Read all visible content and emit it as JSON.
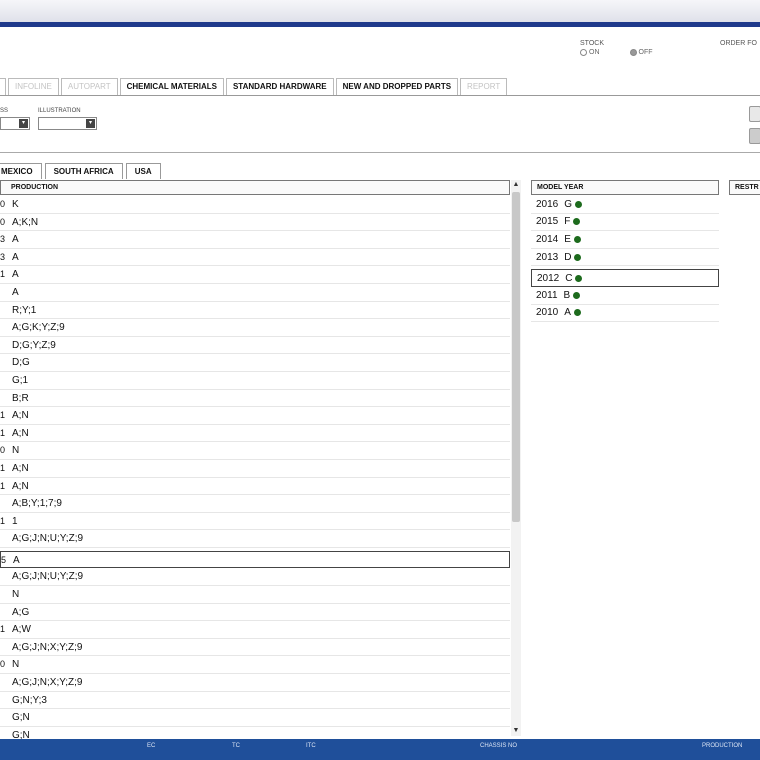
{
  "stock": {
    "label": "STOCK",
    "on_label": "ON",
    "off_label": "OFF"
  },
  "order_label": "ORDER FO",
  "tabs": [
    {
      "label": "",
      "disabled": true
    },
    {
      "label": "INFOLINE",
      "disabled": true
    },
    {
      "label": "AUTOPART",
      "disabled": true
    },
    {
      "label": "CHEMICAL MATERIALS",
      "disabled": false
    },
    {
      "label": "STANDARD HARDWARE",
      "disabled": false
    },
    {
      "label": "NEW AND DROPPED PARTS",
      "disabled": false
    },
    {
      "label": "REPORT",
      "disabled": true
    }
  ],
  "filters": {
    "first_label": "SS",
    "illustration_label": "ILLUSTRATION"
  },
  "country_tabs": [
    "MEXICO",
    "SOUTH AFRICA",
    "USA"
  ],
  "production": {
    "header": "PRODUCTION",
    "rows": [
      {
        "m": "0",
        "v": "K"
      },
      {
        "m": "0",
        "v": "A;K;N"
      },
      {
        "m": "3",
        "v": "A"
      },
      {
        "m": "3",
        "v": "A"
      },
      {
        "m": "1",
        "v": "A"
      },
      {
        "m": "",
        "v": "A"
      },
      {
        "m": "",
        "v": "R;Y;1"
      },
      {
        "m": "",
        "v": "A;G;K;Y;Z;9"
      },
      {
        "m": "",
        "v": "D;G;Y;Z;9"
      },
      {
        "m": "",
        "v": "D;G"
      },
      {
        "m": "",
        "v": "G;1"
      },
      {
        "m": "",
        "v": "B;R"
      },
      {
        "m": "1",
        "v": "A;N"
      },
      {
        "m": "1",
        "v": "A;N"
      },
      {
        "m": "0",
        "v": "N"
      },
      {
        "m": "1",
        "v": "A;N"
      },
      {
        "m": "1",
        "v": "A;N"
      },
      {
        "m": "",
        "v": "A;B;Y;1;7;9"
      },
      {
        "m": "1",
        "v": "1"
      },
      {
        "m": "",
        "v": "A;G;J;N;U;Y;Z;9"
      },
      {
        "m": "5",
        "v": "A",
        "selected": true
      },
      {
        "m": "",
        "v": "A;G;J;N;U;Y;Z;9"
      },
      {
        "m": "",
        "v": "N"
      },
      {
        "m": "",
        "v": "A;G"
      },
      {
        "m": "1",
        "v": "A;W"
      },
      {
        "m": "",
        "v": "A;G;J;N;X;Y;Z;9"
      },
      {
        "m": "0",
        "v": "N"
      },
      {
        "m": "",
        "v": "A;G;J;N;X;Y;Z;9"
      },
      {
        "m": "",
        "v": "G;N;Y;3"
      },
      {
        "m": "",
        "v": "G;N"
      },
      {
        "m": "",
        "v": "G;N"
      }
    ]
  },
  "model_year": {
    "header": "MODEL YEAR",
    "rows": [
      {
        "year": "2016",
        "code": "G",
        "selected": false
      },
      {
        "year": "2015",
        "code": "F",
        "selected": false
      },
      {
        "year": "2014",
        "code": "E",
        "selected": false
      },
      {
        "year": "2013",
        "code": "D",
        "selected": false
      },
      {
        "year": "2012",
        "code": "C",
        "selected": true
      },
      {
        "year": "2011",
        "code": "B",
        "selected": false
      },
      {
        "year": "2010",
        "code": "A",
        "selected": false
      }
    ],
    "dot_color": "#1d6b1d"
  },
  "rest_header": "RESTR",
  "statusbar": {
    "items": [
      "EC",
      "TC",
      "ITC",
      "CHASSIS NO",
      "PRODUCTION"
    ]
  },
  "colors": {
    "accent": "#1f3a8c",
    "status": "#1f4f9a"
  }
}
